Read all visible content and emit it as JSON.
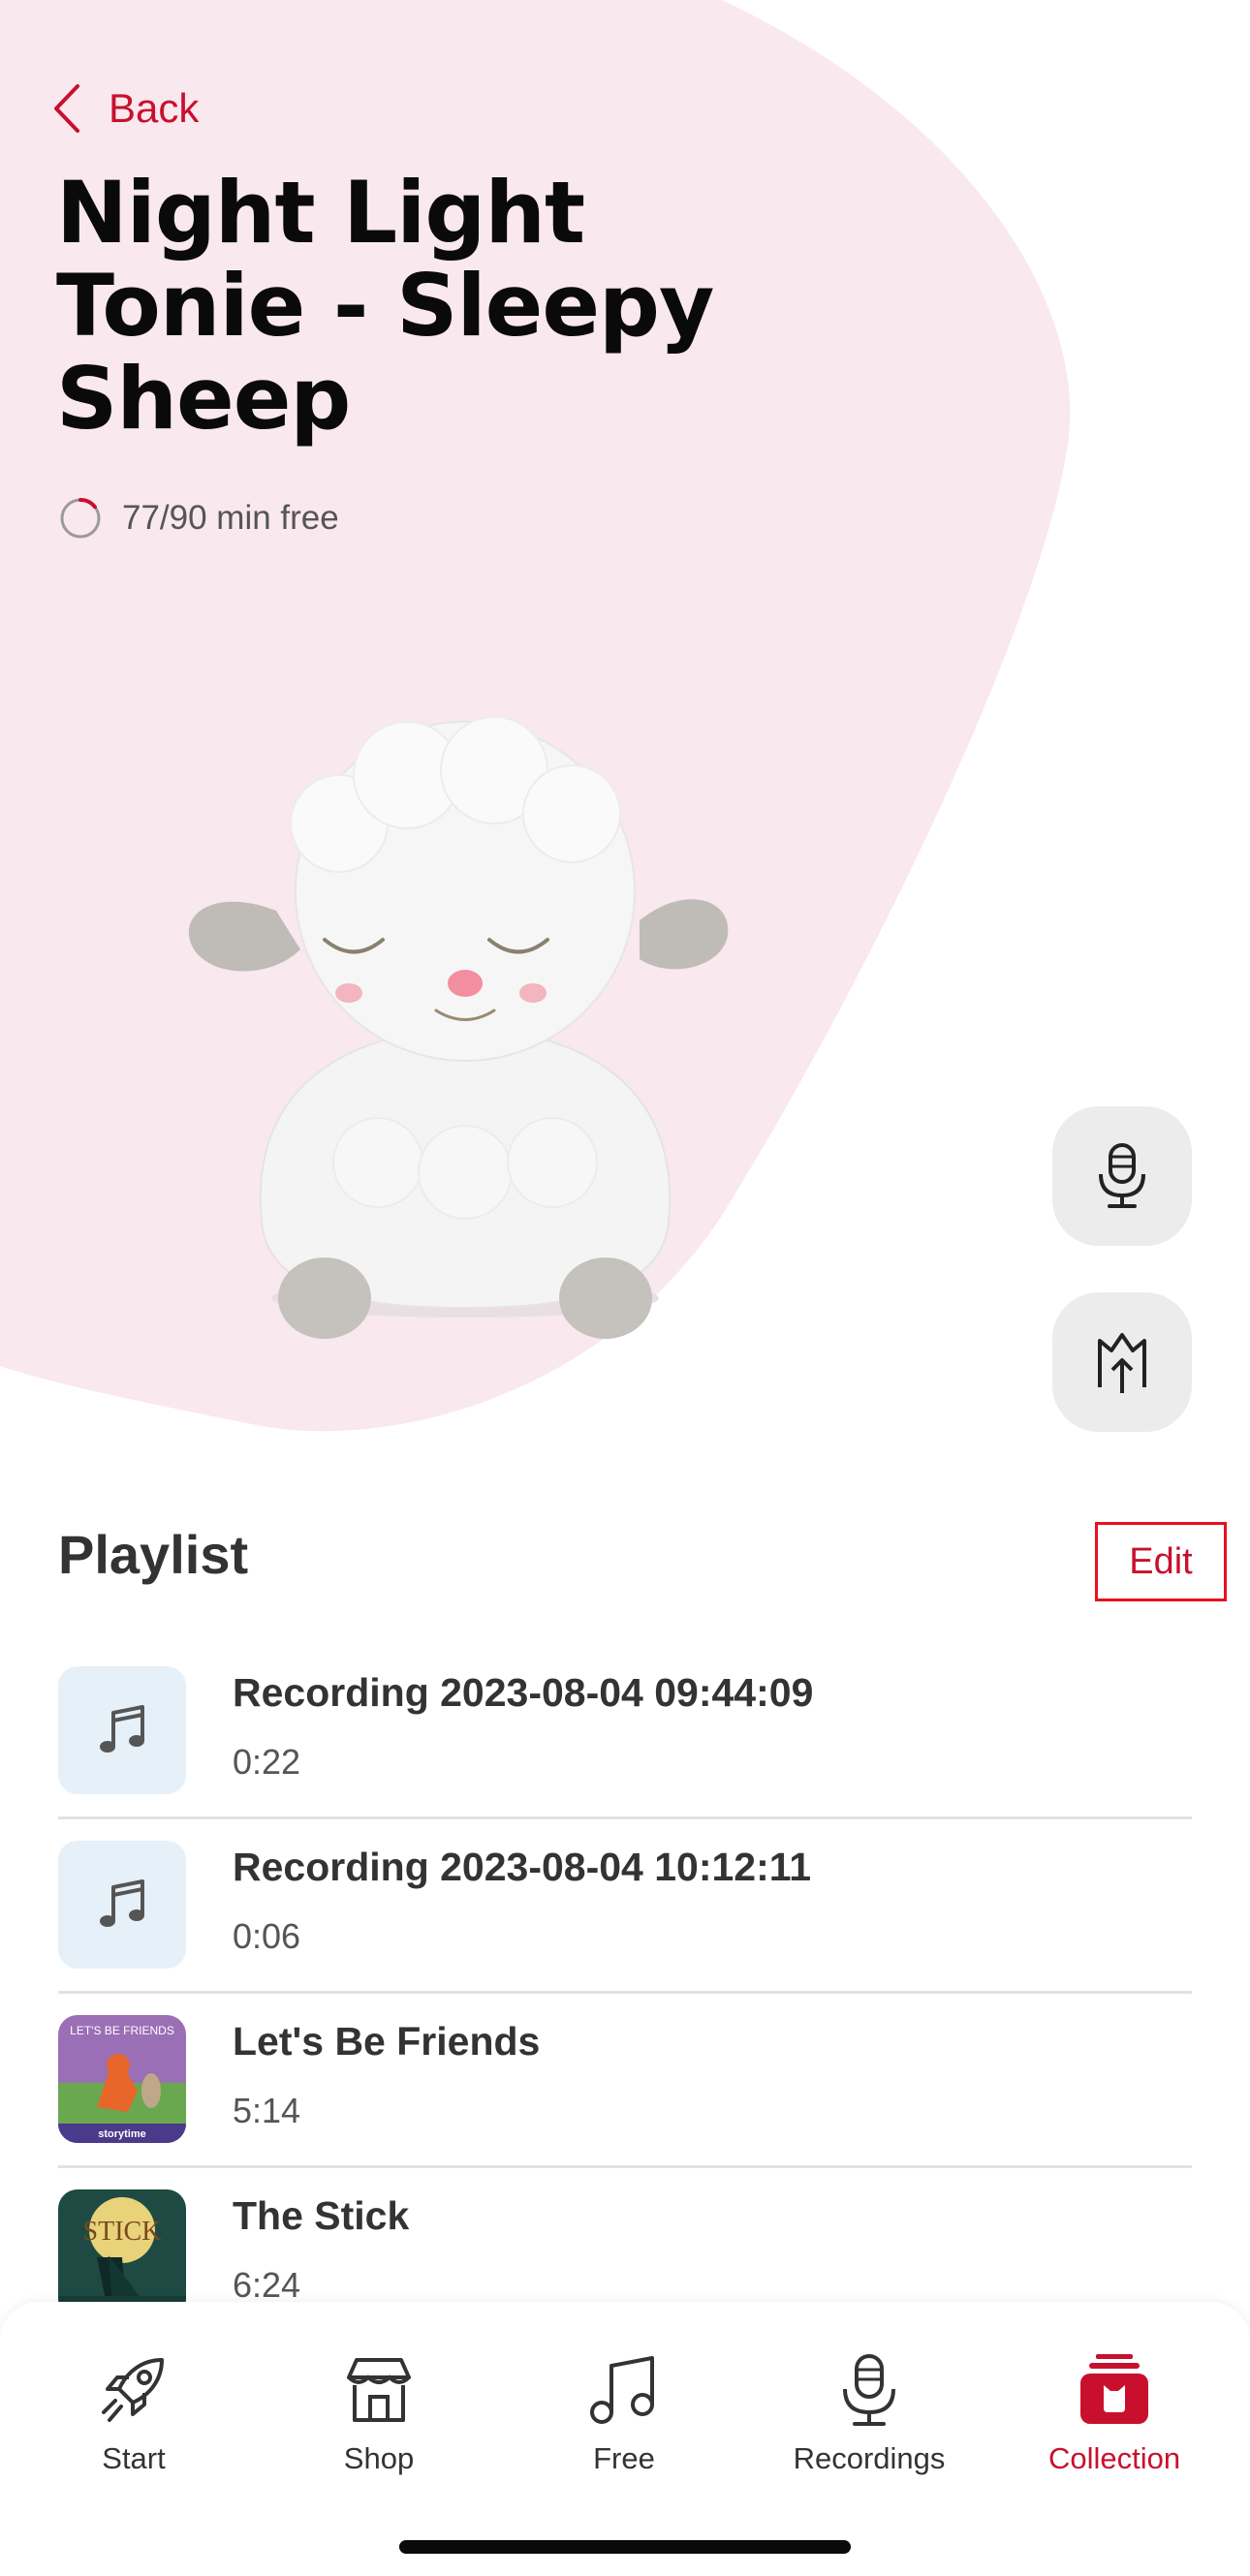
{
  "colors": {
    "accent": "#c8102e",
    "hero_background": "#f9e8ee",
    "edit_highlight": "#e8101e"
  },
  "header": {
    "back_label": "Back"
  },
  "tonie": {
    "title": "Night Light Tonie - Sleepy Sheep",
    "capacity_text": "77/90 min free",
    "capacity_used_fraction": 0.144
  },
  "actions": [
    {
      "name": "record-button",
      "icon": "microphone-icon"
    },
    {
      "name": "upload-button",
      "icon": "upload-icon"
    }
  ],
  "playlist": {
    "title": "Playlist",
    "edit_label": "Edit",
    "items": [
      {
        "title": "Recording 2023-08-04 09:44:09",
        "duration": "0:22",
        "thumb": "music-note-icon"
      },
      {
        "title": "Recording 2023-08-04 10:12:11",
        "duration": "0:06",
        "thumb": "music-note-icon"
      },
      {
        "title": "Let's Be Friends",
        "duration": "5:14",
        "thumb": "cover-lets-be-friends",
        "cover_text": "LET'S BE FRIENDS",
        "cover_subtext": "storytime"
      },
      {
        "title": "The Stick",
        "duration": "6:24",
        "thumb": "cover-the-stick",
        "cover_text": "STICK"
      }
    ]
  },
  "tabbar": {
    "tabs": [
      {
        "label": "Start",
        "icon": "rocket-icon",
        "active": false
      },
      {
        "label": "Shop",
        "icon": "store-icon",
        "active": false
      },
      {
        "label": "Free",
        "icon": "music-note-icon",
        "active": false
      },
      {
        "label": "Recordings",
        "icon": "microphone-icon",
        "active": false
      },
      {
        "label": "Collection",
        "icon": "collection-icon",
        "active": true
      }
    ]
  }
}
